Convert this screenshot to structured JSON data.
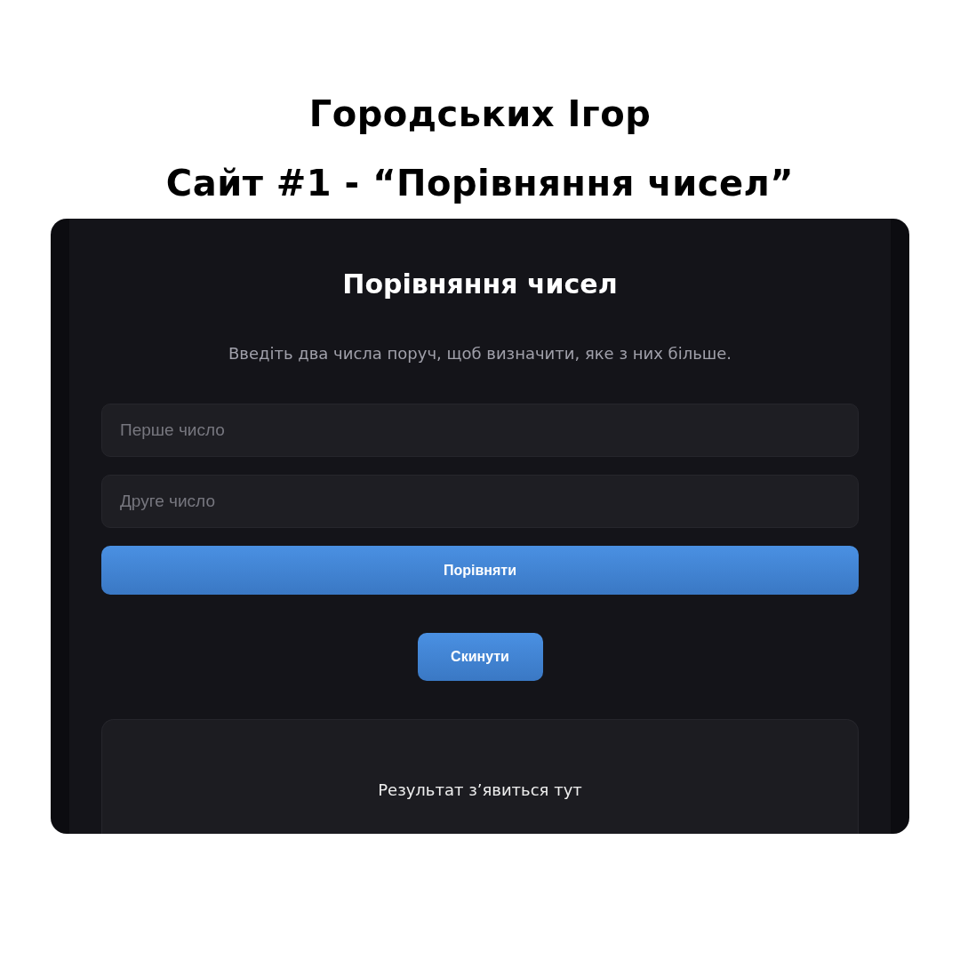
{
  "heading": {
    "author": "Городських Ігор",
    "subtitle": "Сайт #1 - “Порівняння чисел”"
  },
  "app": {
    "title": "Порівняння чисел",
    "description": "Введіть два числа поруч, щоб визначити, яке з них більше.",
    "fields": [
      {
        "placeholder": "Перше число"
      },
      {
        "placeholder": "Друге число"
      }
    ],
    "compare_button": "Порівняти",
    "reset_button": "Скинути",
    "result": "Результат з’явиться тут"
  }
}
